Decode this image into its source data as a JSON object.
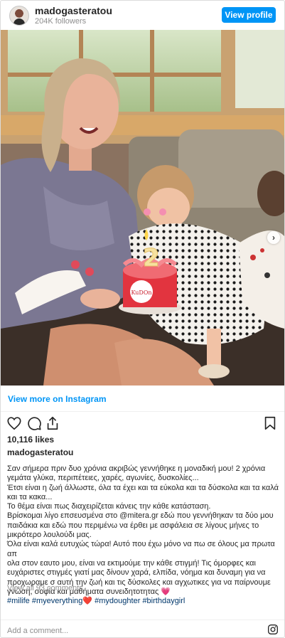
{
  "header": {
    "username": "madogasteratou",
    "followers": "204K followers",
    "view_profile": "View profile"
  },
  "post": {
    "cake_topper": "KuDOn",
    "carousel_index": 1,
    "carousel_total": 2
  },
  "view_more": "View more on Instagram",
  "likes": "10,116 likes",
  "caption_user": "madogasteratou",
  "caption": {
    "l1": "Σαν σήμερα πριν δυο χρόνια ακριβώς γεννήθηκε η μοναδική μου! 2 χρόνια",
    "l2": "γεμάτα γλύκα, περιπέτειες, χαρές, αγωνίες, δυσκολίες...",
    "l3": "Έτσι είναι η ζωή άλλωστε, όλα τα έχει και τα εύκολα και τα δύσκολα και τα καλά",
    "l4": "και τα κακα...",
    "l5": "Το θέμα είναι πως διαχειρίζεται κάνεις την κάθε κατάσταση.",
    "l6": "Βρίσκομαι λίγο επσευσμένα στο @mitera.gr εδώ που γεννήθηκαν τα δύο μου",
    "l7": "παιδάκια και εδώ που περιμένω να έρθει με ασφάλεια σε λίγους μήνες το",
    "l8": "μικρότερο λουλούδι μας.",
    "l9": "Όλα είναι καλά ευτυχώς τώρα! Αυτό που έχω μόνο να πω σε όλους μα πρωτα απ",
    "l10": "ολα στον εαυτο μου, είναι να εκτιμούμε την κάθε στιγμή! Τις όμορφες και",
    "l11": "ευχάριστες στιγμές γιατί μας δίνουν χαρά, ελπίδα, νόημα και δυναμη για να",
    "l12": "προχωραμε σ αυτή την ζωή και τις δύσκολες και αγχωτικες για να παίρνουμε",
    "l13": "γνώση, σοφία και μαθήματα συνειδητοτητας 💗",
    "hashtags": [
      "#milife",
      "#myeverything❤️",
      "#mydoughter",
      "#birthdaygirl"
    ]
  },
  "view_all": "View all 93 comments",
  "add_comment": "Add a comment...",
  "colors": {
    "accent": "#0095f6",
    "link": "#00376b",
    "muted": "#8e8e8e"
  },
  "icons": [
    "heart-icon",
    "comment-icon",
    "share-icon",
    "bookmark-icon",
    "instagram-logo-icon",
    "chevron-right-icon"
  ]
}
